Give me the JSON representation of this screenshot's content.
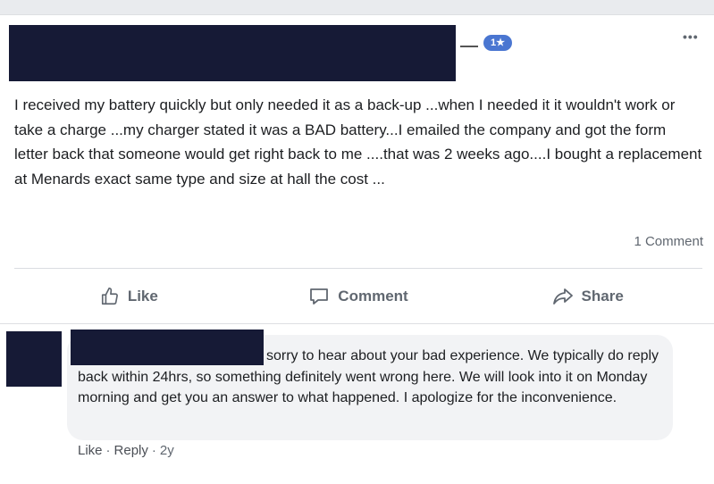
{
  "post": {
    "rating_badge": "1★",
    "more_label": "•••",
    "text": "I received my battery quickly but only needed it as a back-up ...when I needed it it wouldn't work or take a charge ...my charger stated it was a BAD battery...I emailed the company and got the form letter back that someone would get right back to me ....that was 2 weeks ago....I bought a replacement at Menards exact same type and size at hall the cost ...",
    "comment_count": "1 Comment"
  },
  "actions": {
    "like": "Like",
    "comment": "Comment",
    "share": "Share"
  },
  "comment": {
    "text": "sorry to hear about your bad experience. We typically do reply back within 24hrs, so something definitely went wrong here. We will look into it on Monday morning and get you an answer to what happened. I apologize for the inconvenience.",
    "like": "Like",
    "reply": "Reply",
    "time": "2y",
    "separator": "·"
  },
  "colors": {
    "redaction": "#161a36",
    "badge": "#4a76d1",
    "muted_text": "#606770"
  }
}
